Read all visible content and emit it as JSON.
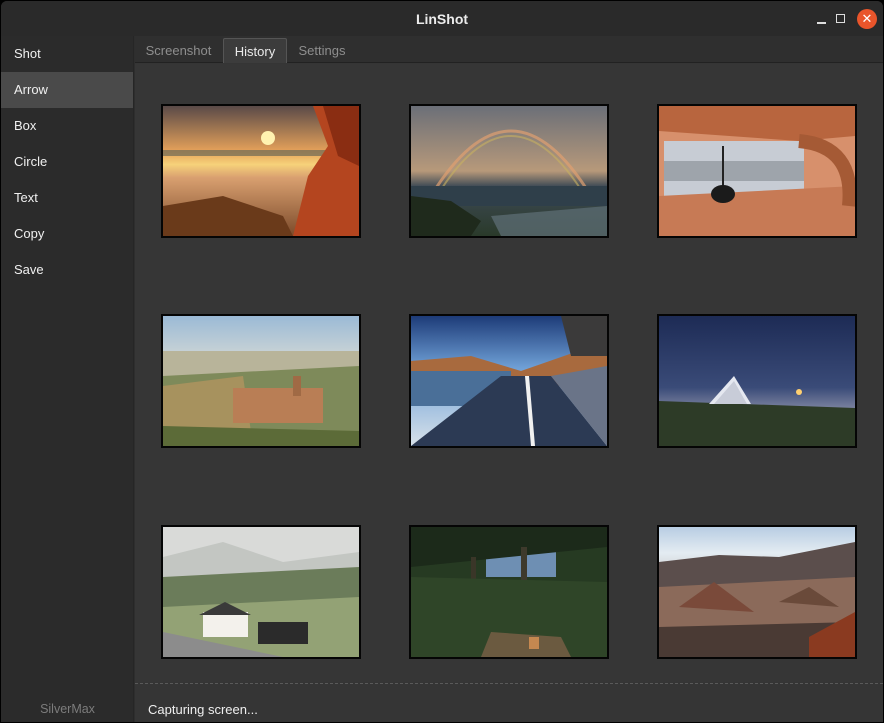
{
  "window": {
    "title": "LinShot"
  },
  "sidebar": {
    "items": [
      {
        "label": "Shot"
      },
      {
        "label": "Arrow"
      },
      {
        "label": "Box"
      },
      {
        "label": "Circle"
      },
      {
        "label": "Text"
      },
      {
        "label": "Copy"
      },
      {
        "label": "Save"
      }
    ],
    "active_index": 1,
    "footer": "SilverMax"
  },
  "tabs": [
    {
      "label": "Screenshot"
    },
    {
      "label": "History"
    },
    {
      "label": "Settings"
    }
  ],
  "active_tab": 1,
  "history": {
    "thumbnails": [
      {
        "name": "thumbnail-autumn-lake-sunset"
      },
      {
        "name": "thumbnail-rainbow-coast"
      },
      {
        "name": "thumbnail-wooden-cabin-interior"
      },
      {
        "name": "thumbnail-palace-valley"
      },
      {
        "name": "thumbnail-mountain-road"
      },
      {
        "name": "thumbnail-glass-house-night"
      },
      {
        "name": "thumbnail-foggy-village"
      },
      {
        "name": "thumbnail-forest-path"
      },
      {
        "name": "thumbnail-volcanic-crater"
      }
    ]
  },
  "status": {
    "message": "Capturing screen..."
  },
  "colors": {
    "accent_close": "#e9552b",
    "active_sidebar": "#4a4a4a"
  }
}
